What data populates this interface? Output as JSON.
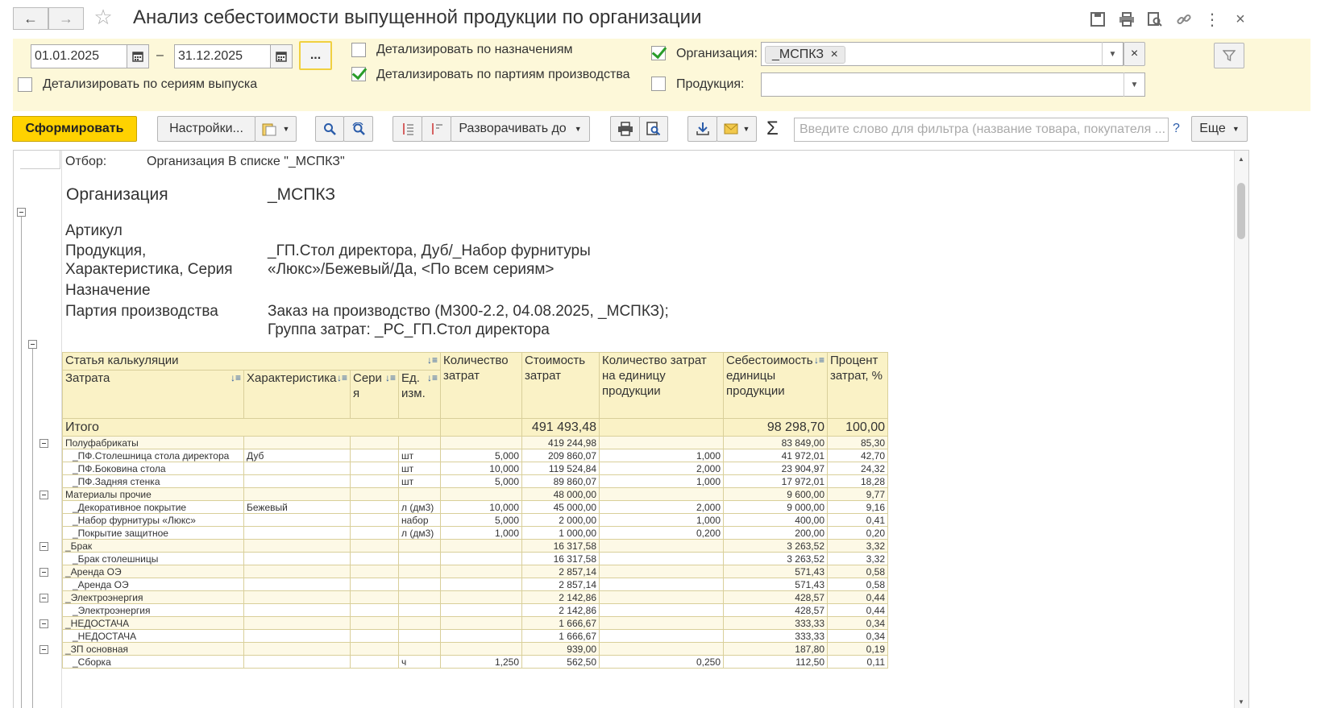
{
  "window": {
    "title": "Анализ себестоимости выпущенной продукции по организации"
  },
  "params": {
    "date_from": "01.01.2025",
    "date_to": "31.12.2025",
    "date_sep": "–",
    "more_btn": "...",
    "chk_series_label": "Детализировать по сериям выпуска",
    "chk_purpose_label": "Детализировать по назначениям",
    "chk_batch_label": "Детализировать по партиям производства",
    "org_label": "Организация:",
    "org_value": "_МСПКЗ",
    "product_label": "Продукция:",
    "chk_series": false,
    "chk_purpose": false,
    "chk_batch": true,
    "chk_org": true,
    "chk_product": false
  },
  "toolbar": {
    "generate": "Сформировать",
    "settings": "Настройки...",
    "expand_to": "Разворачивать до",
    "search_placeholder": "Введите слово для фильтра (название товара, покупателя ...",
    "help": "?",
    "more": "Еще"
  },
  "report": {
    "filter_label": "Отбор:",
    "filter_value": "Организация В списке \"_МСПКЗ\"",
    "org_label": "Организация",
    "org_value": "_МСПКЗ",
    "article_label": "Артикул",
    "product_label_1": "Продукция,",
    "product_label_2": "Характеристика, Серия",
    "product_value_1": "_ГП.Стол директора, Дуб/_Набор фурнитуры",
    "product_value_2": "«Люкс»/Бежевый/Да, <По всем сериям>",
    "purpose_label": "Назначение",
    "batch_label": "Партия производства",
    "batch_value_1": "Заказ на производство (М300-2.2, 04.08.2025, _МСПКЗ);",
    "batch_value_2": "Группа затрат: _РС_ГП.Стол директора",
    "headers": {
      "article": "Статья калькуляции",
      "cost": "Затрата",
      "characteristic": "Характеристика",
      "series": "Серия",
      "unit": "Ед. изм.",
      "qty": "Количество затрат",
      "amount": "Стоимость затрат",
      "qty_per_unit": "Количество затрат на единицу продукции",
      "unit_cost": "Себестоимость единицы продукции",
      "pct": "Процент затрат, %"
    },
    "total": {
      "label": "Итого",
      "amount": "491 493,48",
      "unit_cost": "98 298,70",
      "pct": "100,00"
    },
    "rows": [
      {
        "g": true,
        "name": "Полуфабрикаты",
        "char": "",
        "unit": "",
        "qty": "",
        "amount": "419 244,98",
        "qpu": "",
        "uc": "83 849,00",
        "pct": "85,30"
      },
      {
        "g": false,
        "name": "_ПФ.Столешница стола директора",
        "char": "Дуб",
        "unit": "шт",
        "qty": "5,000",
        "amount": "209 860,07",
        "qpu": "1,000",
        "uc": "41 972,01",
        "pct": "42,70"
      },
      {
        "g": false,
        "name": "_ПФ.Боковина стола",
        "char": "",
        "unit": "шт",
        "qty": "10,000",
        "amount": "119 524,84",
        "qpu": "2,000",
        "uc": "23 904,97",
        "pct": "24,32"
      },
      {
        "g": false,
        "name": "_ПФ.Задняя стенка",
        "char": "",
        "unit": "шт",
        "qty": "5,000",
        "amount": "89 860,07",
        "qpu": "1,000",
        "uc": "17 972,01",
        "pct": "18,28"
      },
      {
        "g": true,
        "name": "Материалы прочие",
        "char": "",
        "unit": "",
        "qty": "",
        "amount": "48 000,00",
        "qpu": "",
        "uc": "9 600,00",
        "pct": "9,77"
      },
      {
        "g": false,
        "name": "_Декоративное покрытие",
        "char": "Бежевый",
        "unit": "л (дм3)",
        "qty": "10,000",
        "amount": "45 000,00",
        "qpu": "2,000",
        "uc": "9 000,00",
        "pct": "9,16"
      },
      {
        "g": false,
        "name": "_Набор фурнитуры «Люкс»",
        "char": "",
        "unit": "набор",
        "qty": "5,000",
        "amount": "2 000,00",
        "qpu": "1,000",
        "uc": "400,00",
        "pct": "0,41"
      },
      {
        "g": false,
        "name": "_Покрытие защитное",
        "char": "",
        "unit": "л (дм3)",
        "qty": "1,000",
        "amount": "1 000,00",
        "qpu": "0,200",
        "uc": "200,00",
        "pct": "0,20"
      },
      {
        "g": true,
        "name": "_Брак",
        "char": "",
        "unit": "",
        "qty": "",
        "amount": "16 317,58",
        "qpu": "",
        "uc": "3 263,52",
        "pct": "3,32"
      },
      {
        "g": false,
        "name": "_Брак столешницы",
        "char": "",
        "unit": "",
        "qty": "",
        "amount": "16 317,58",
        "qpu": "",
        "uc": "3 263,52",
        "pct": "3,32"
      },
      {
        "g": true,
        "name": "_Аренда ОЭ",
        "char": "",
        "unit": "",
        "qty": "",
        "amount": "2 857,14",
        "qpu": "",
        "uc": "571,43",
        "pct": "0,58"
      },
      {
        "g": false,
        "name": "_Аренда ОЭ",
        "char": "",
        "unit": "",
        "qty": "",
        "amount": "2 857,14",
        "qpu": "",
        "uc": "571,43",
        "pct": "0,58"
      },
      {
        "g": true,
        "name": "_Электроэнергия",
        "char": "",
        "unit": "",
        "qty": "",
        "amount": "2 142,86",
        "qpu": "",
        "uc": "428,57",
        "pct": "0,44"
      },
      {
        "g": false,
        "name": "_Электроэнергия",
        "char": "",
        "unit": "",
        "qty": "",
        "amount": "2 142,86",
        "qpu": "",
        "uc": "428,57",
        "pct": "0,44"
      },
      {
        "g": true,
        "name": "_НЕДОСТАЧА",
        "char": "",
        "unit": "",
        "qty": "",
        "amount": "1 666,67",
        "qpu": "",
        "uc": "333,33",
        "pct": "0,34"
      },
      {
        "g": false,
        "name": "_НЕДОСТАЧА",
        "char": "",
        "unit": "",
        "qty": "",
        "amount": "1 666,67",
        "qpu": "",
        "uc": "333,33",
        "pct": "0,34"
      },
      {
        "g": true,
        "name": "_ЗП основная",
        "char": "",
        "unit": "",
        "qty": "",
        "amount": "939,00",
        "qpu": "",
        "uc": "187,80",
        "pct": "0,19"
      },
      {
        "g": false,
        "name": "_Сборка",
        "char": "",
        "unit": "ч",
        "qty": "1,250",
        "amount": "562,50",
        "qpu": "0,250",
        "uc": "112,50",
        "pct": "0,11"
      }
    ]
  }
}
